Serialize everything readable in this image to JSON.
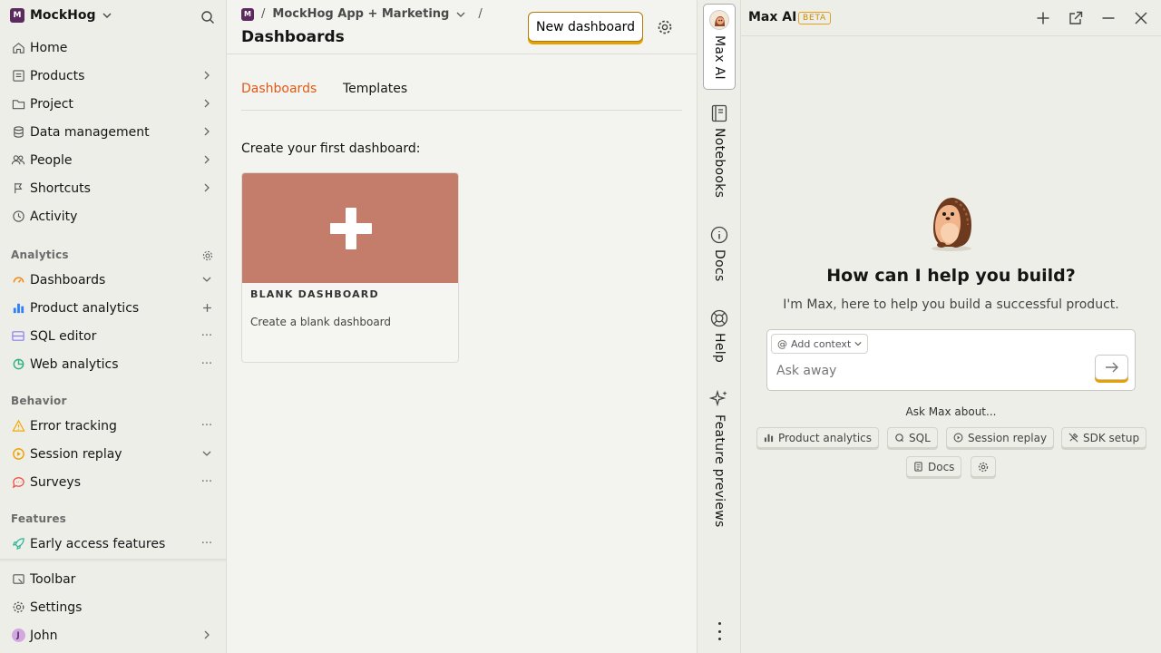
{
  "sidebar": {
    "org_badge": "M",
    "org_name": "MockHog",
    "nav": [
      {
        "label": "Home",
        "icon": "home-icon"
      },
      {
        "label": "Products",
        "icon": "products-icon"
      },
      {
        "label": "Project",
        "icon": "folder-icon"
      },
      {
        "label": "Data management",
        "icon": "database-icon"
      },
      {
        "label": "People",
        "icon": "people-icon"
      },
      {
        "label": "Shortcuts",
        "icon": "shortcuts-icon"
      },
      {
        "label": "Activity",
        "icon": "clock-icon"
      }
    ],
    "analytics": {
      "heading": "Analytics",
      "items": [
        {
          "label": "Dashboards",
          "icon": "dashboard-icon"
        },
        {
          "label": "Product analytics",
          "icon": "bar-chart-icon"
        },
        {
          "label": "SQL editor",
          "icon": "sql-icon"
        },
        {
          "label": "Web analytics",
          "icon": "web-analytics-icon"
        }
      ]
    },
    "behavior": {
      "heading": "Behavior",
      "items": [
        {
          "label": "Error tracking",
          "icon": "warning-icon"
        },
        {
          "label": "Session replay",
          "icon": "replay-icon"
        },
        {
          "label": "Surveys",
          "icon": "survey-icon"
        }
      ]
    },
    "features": {
      "heading": "Features",
      "items": [
        {
          "label": "Early access features",
          "icon": "rocket-icon"
        }
      ]
    },
    "bottom": [
      {
        "label": "Toolbar",
        "icon": "toolbar-icon"
      },
      {
        "label": "Settings",
        "icon": "gear-icon"
      },
      {
        "label": "John",
        "icon": "avatar"
      }
    ],
    "user_initial": "J"
  },
  "main": {
    "breadcrumb": {
      "badge": "M",
      "project": "MockHog App + Marketing",
      "sep": "/"
    },
    "title": "Dashboards",
    "new_button": "New dashboard",
    "tabs": [
      "Dashboards",
      "Templates"
    ],
    "intro": "Create your first dashboard:",
    "card": {
      "title": "BLANK DASHBOARD",
      "description": "Create a blank dashboard"
    }
  },
  "sidetabs": [
    "Max AI",
    "Notebooks",
    "Docs",
    "Help",
    "Feature previews"
  ],
  "ai": {
    "title": "Max AI",
    "badge": "BETA",
    "heading": "How can I help you build?",
    "subheading": "I'm Max, here to help you build a successful product.",
    "context_button": "Add context",
    "placeholder": "Ask away",
    "ask_about": "Ask Max about...",
    "suggestions": [
      "Product analytics",
      "SQL",
      "Session replay",
      "SDK setup",
      "Docs"
    ]
  },
  "colors": {
    "accent": "#e05a17",
    "brand": "#e6a100",
    "card_bg": "#c47c6b"
  }
}
